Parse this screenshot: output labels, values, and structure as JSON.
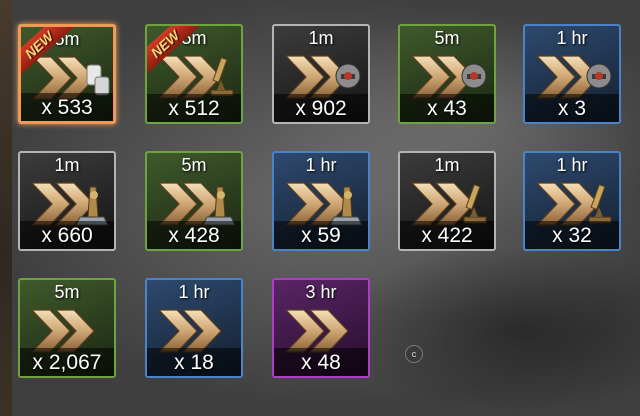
{
  "items": [
    {
      "duration": "5m",
      "quantity": "x 533",
      "rarity": "green",
      "art": "barrels-icon",
      "badge": "NEW",
      "selected": true
    },
    {
      "duration": "5m",
      "quantity": "x 512",
      "rarity": "green",
      "art": "microscope-icon",
      "badge": "NEW",
      "selected": false
    },
    {
      "duration": "1m",
      "quantity": "x 902",
      "rarity": "gray",
      "art": "helmet-icon",
      "badge": "",
      "selected": false
    },
    {
      "duration": "5m",
      "quantity": "x 43",
      "rarity": "green",
      "art": "helmet-icon",
      "badge": "",
      "selected": false
    },
    {
      "duration": "1 hr",
      "quantity": "x 3",
      "rarity": "blue",
      "art": "helmet-icon",
      "badge": "",
      "selected": false
    },
    {
      "duration": "1m",
      "quantity": "x 660",
      "rarity": "gray",
      "art": "anvil-icon",
      "badge": "",
      "selected": false
    },
    {
      "duration": "5m",
      "quantity": "x 428",
      "rarity": "green",
      "art": "anvil-icon",
      "badge": "",
      "selected": false
    },
    {
      "duration": "1 hr",
      "quantity": "x 59",
      "rarity": "blue",
      "art": "anvil-icon",
      "badge": "",
      "selected": false
    },
    {
      "duration": "1m",
      "quantity": "x 422",
      "rarity": "gray",
      "art": "microscope-icon",
      "badge": "",
      "selected": false
    },
    {
      "duration": "1 hr",
      "quantity": "x 32",
      "rarity": "blue",
      "art": "microscope-icon",
      "badge": "",
      "selected": false
    },
    {
      "duration": "5m",
      "quantity": "x 2,067",
      "rarity": "green",
      "art": "",
      "badge": "",
      "selected": false
    },
    {
      "duration": "1 hr",
      "quantity": "x 18",
      "rarity": "blue",
      "art": "",
      "badge": "",
      "selected": false
    },
    {
      "duration": "3 hr",
      "quantity": "x 48",
      "rarity": "purple",
      "art": "",
      "badge": "",
      "selected": false
    }
  ],
  "cursor_label": "c",
  "colors": {
    "rarity_gray": "#b4b4b4",
    "rarity_green": "#6fa341",
    "rarity_blue": "#4a83c7",
    "rarity_purple": "#b03dc8",
    "selected_border": "#f09a55",
    "new_ribbon": "#c0301c"
  }
}
